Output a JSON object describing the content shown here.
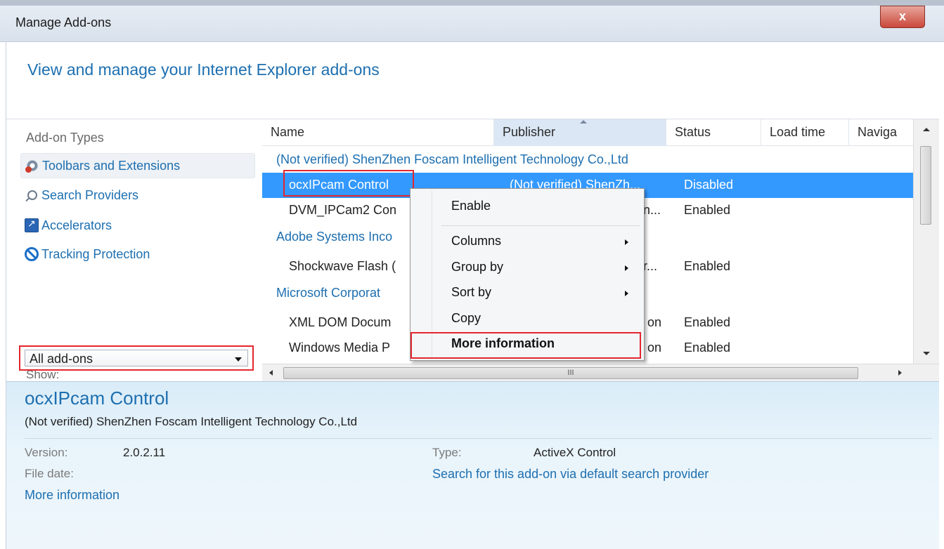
{
  "window": {
    "title": "Manage Add-ons",
    "close_label": "x"
  },
  "header": {
    "title": "View and manage your Internet Explorer add-ons"
  },
  "sidebar": {
    "heading": "Add-on Types",
    "items": [
      {
        "label": "Toolbars and Extensions",
        "icon": "toolbars-extensions-icon",
        "selected": true
      },
      {
        "label": "Search Providers",
        "icon": "search-icon",
        "selected": false
      },
      {
        "label": "Accelerators",
        "icon": "accelerator-icon",
        "selected": false
      },
      {
        "label": "Tracking Protection",
        "icon": "tracking-protection-icon",
        "selected": false
      }
    ],
    "show_label": "Show:",
    "show_value": "All add-ons"
  },
  "list": {
    "columns": [
      "Name",
      "Publisher",
      "Status",
      "Load time",
      "Naviga"
    ],
    "sorted_column": "Publisher",
    "groups": [
      {
        "label": "(Not verified) ShenZhen Foscam Intelligent Technology Co.,Ltd"
      },
      {
        "label": "Adobe Systems Inco"
      },
      {
        "label": "Microsoft Corporat"
      }
    ],
    "rows": [
      {
        "name": "ocxIPcam Control",
        "publisher": "(Not verified) ShenZh...",
        "status": "Disabled",
        "selected": true
      },
      {
        "name": "DVM_IPCam2 Con",
        "publisher": "n...",
        "status": "Enabled"
      },
      {
        "name": "Shockwave Flash (",
        "publisher": "r...",
        "status": "Enabled"
      },
      {
        "name": "XML DOM Docum",
        "publisher": "on",
        "status": "Enabled"
      },
      {
        "name": "Windows Media P",
        "publisher": "on",
        "status": "Enabled"
      }
    ],
    "hscroll_grip": "III"
  },
  "context_menu": {
    "items": [
      {
        "label": "Enable"
      },
      {
        "label": "Columns",
        "submenu": true
      },
      {
        "label": "Group by",
        "submenu": true
      },
      {
        "label": "Sort by",
        "submenu": true
      },
      {
        "label": "Copy"
      },
      {
        "label": "More information",
        "bold": true
      }
    ]
  },
  "details": {
    "name": "ocxIPcam Control",
    "publisher": "(Not verified) ShenZhen Foscam Intelligent Technology Co.,Ltd",
    "version_label": "Version:",
    "version_value": "2.0.2.11",
    "file_date_label": "File date:",
    "more_info_link": "More information",
    "type_label": "Type:",
    "type_value": "ActiveX Control",
    "search_link": "Search for this add-on via default search provider"
  },
  "colors": {
    "accent": "#1d6fb0",
    "selection": "#3399ff",
    "highlight_box": "#e3262f"
  }
}
